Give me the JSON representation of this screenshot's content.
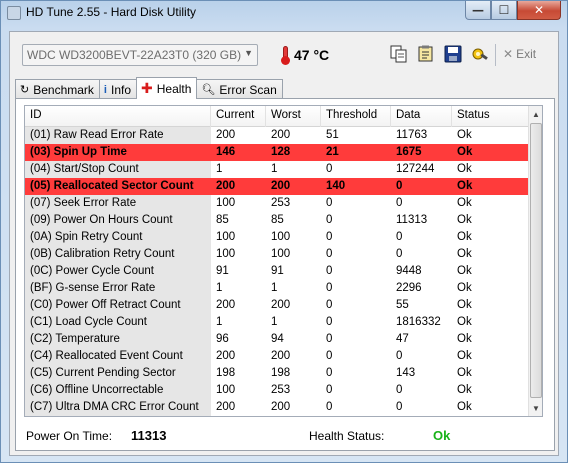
{
  "window": {
    "title": "HD Tune 2.55 - Hard Disk Utility",
    "caption_buttons": {
      "minimize": "—",
      "maximize": "☐",
      "close": "✕"
    }
  },
  "toolbar": {
    "drive": "WDC WD3200BEVT-22A23T0 (320 GB)",
    "temperature": "47 °C",
    "icons": [
      "copy-icon",
      "copy-text-icon",
      "save-icon",
      "options-icon"
    ],
    "exit_label": "Exit"
  },
  "tabs": [
    {
      "label": "Benchmark",
      "icon": "benchmark-icon",
      "active": false
    },
    {
      "label": "Info",
      "icon": "info-icon",
      "active": false
    },
    {
      "label": "Health",
      "icon": "health-cross-icon",
      "active": true
    },
    {
      "label": "Error Scan",
      "icon": "magnifier-icon",
      "active": false
    }
  ],
  "table": {
    "columns": [
      "ID",
      "Current",
      "Worst",
      "Threshold",
      "Data",
      "Status"
    ],
    "rows": [
      {
        "id": "(01) Raw Read Error Rate",
        "current": "200",
        "worst": "200",
        "threshold": "51",
        "data": "11763",
        "status": "Ok",
        "warn": false
      },
      {
        "id": "(03) Spin Up Time",
        "current": "146",
        "worst": "128",
        "threshold": "21",
        "data": "1675",
        "status": "Ok",
        "warn": true
      },
      {
        "id": "(04) Start/Stop Count",
        "current": "1",
        "worst": "1",
        "threshold": "0",
        "data": "127244",
        "status": "Ok",
        "warn": false
      },
      {
        "id": "(05) Reallocated Sector Count",
        "current": "200",
        "worst": "200",
        "threshold": "140",
        "data": "0",
        "status": "Ok",
        "warn": true
      },
      {
        "id": "(07) Seek Error Rate",
        "current": "100",
        "worst": "253",
        "threshold": "0",
        "data": "0",
        "status": "Ok",
        "warn": false
      },
      {
        "id": "(09) Power On Hours Count",
        "current": "85",
        "worst": "85",
        "threshold": "0",
        "data": "11313",
        "status": "Ok",
        "warn": false
      },
      {
        "id": "(0A) Spin Retry Count",
        "current": "100",
        "worst": "100",
        "threshold": "0",
        "data": "0",
        "status": "Ok",
        "warn": false
      },
      {
        "id": "(0B) Calibration Retry Count",
        "current": "100",
        "worst": "100",
        "threshold": "0",
        "data": "0",
        "status": "Ok",
        "warn": false
      },
      {
        "id": "(0C) Power Cycle Count",
        "current": "91",
        "worst": "91",
        "threshold": "0",
        "data": "9448",
        "status": "Ok",
        "warn": false
      },
      {
        "id": "(BF) G-sense Error Rate",
        "current": "1",
        "worst": "1",
        "threshold": "0",
        "data": "2296",
        "status": "Ok",
        "warn": false
      },
      {
        "id": "(C0) Power Off Retract Count",
        "current": "200",
        "worst": "200",
        "threshold": "0",
        "data": "55",
        "status": "Ok",
        "warn": false
      },
      {
        "id": "(C1) Load Cycle Count",
        "current": "1",
        "worst": "1",
        "threshold": "0",
        "data": "1816332",
        "status": "Ok",
        "warn": false
      },
      {
        "id": "(C2) Temperature",
        "current": "96",
        "worst": "94",
        "threshold": "0",
        "data": "47",
        "status": "Ok",
        "warn": false
      },
      {
        "id": "(C4) Reallocated Event Count",
        "current": "200",
        "worst": "200",
        "threshold": "0",
        "data": "0",
        "status": "Ok",
        "warn": false
      },
      {
        "id": "(C5) Current Pending Sector",
        "current": "198",
        "worst": "198",
        "threshold": "0",
        "data": "143",
        "status": "Ok",
        "warn": false
      },
      {
        "id": "(C6) Offline Uncorrectable",
        "current": "100",
        "worst": "253",
        "threshold": "0",
        "data": "0",
        "status": "Ok",
        "warn": false
      },
      {
        "id": "(C7) Ultra DMA CRC Error Count",
        "current": "200",
        "worst": "200",
        "threshold": "0",
        "data": "0",
        "status": "Ok",
        "warn": false
      }
    ]
  },
  "footer": {
    "power_on_label": "Power On Time:",
    "power_on_value": "11313",
    "health_label": "Health Status:",
    "health_value": "Ok"
  },
  "colors": {
    "warn_row": "#ff3b3b",
    "health_ok": "#19b219",
    "temperature": "#d81c1c"
  }
}
